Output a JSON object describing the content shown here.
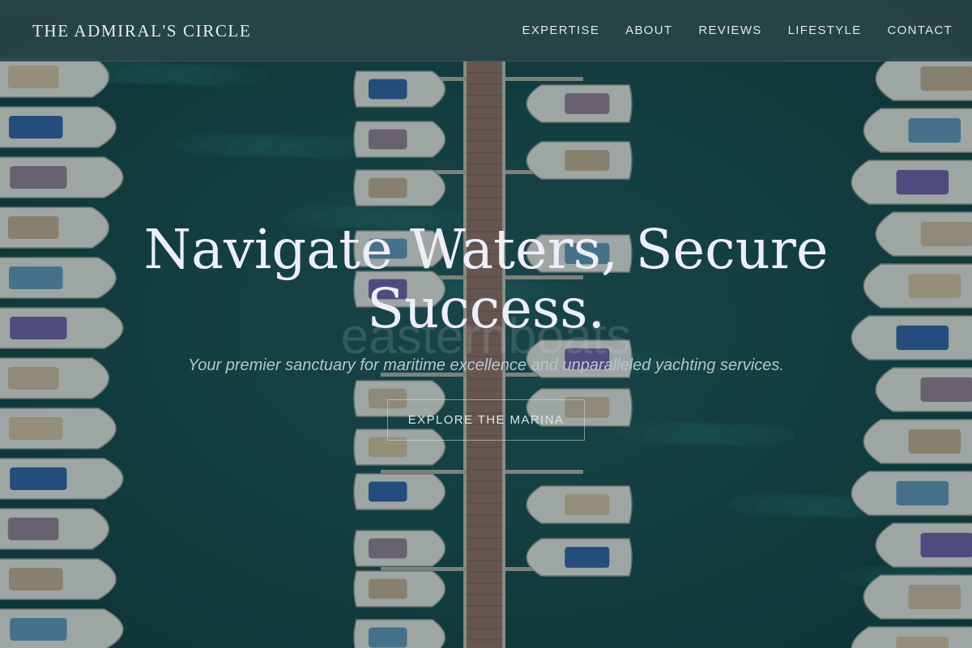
{
  "nav": {
    "brand": "THE ADMIRAL'S CIRCLE",
    "links": [
      "EXPERTISE",
      "ABOUT",
      "REVIEWS",
      "LIFESTYLE",
      "CONTACT"
    ]
  },
  "hero": {
    "headline": "Navigate Waters, Secure Success.",
    "watermark": "easternboats",
    "tagline": "Your premier sanctuary for maritime excellence and unparalleled yachting services.",
    "cta_label": "EXPLORE THE MARINA",
    "background_image": "aerial-marina-photo"
  },
  "colors": {
    "nav_bg": "#2a4547",
    "water": "#164649",
    "headline": "#eeeef8",
    "tagline": "#b7c6cc",
    "dock": "#8a6a62"
  }
}
